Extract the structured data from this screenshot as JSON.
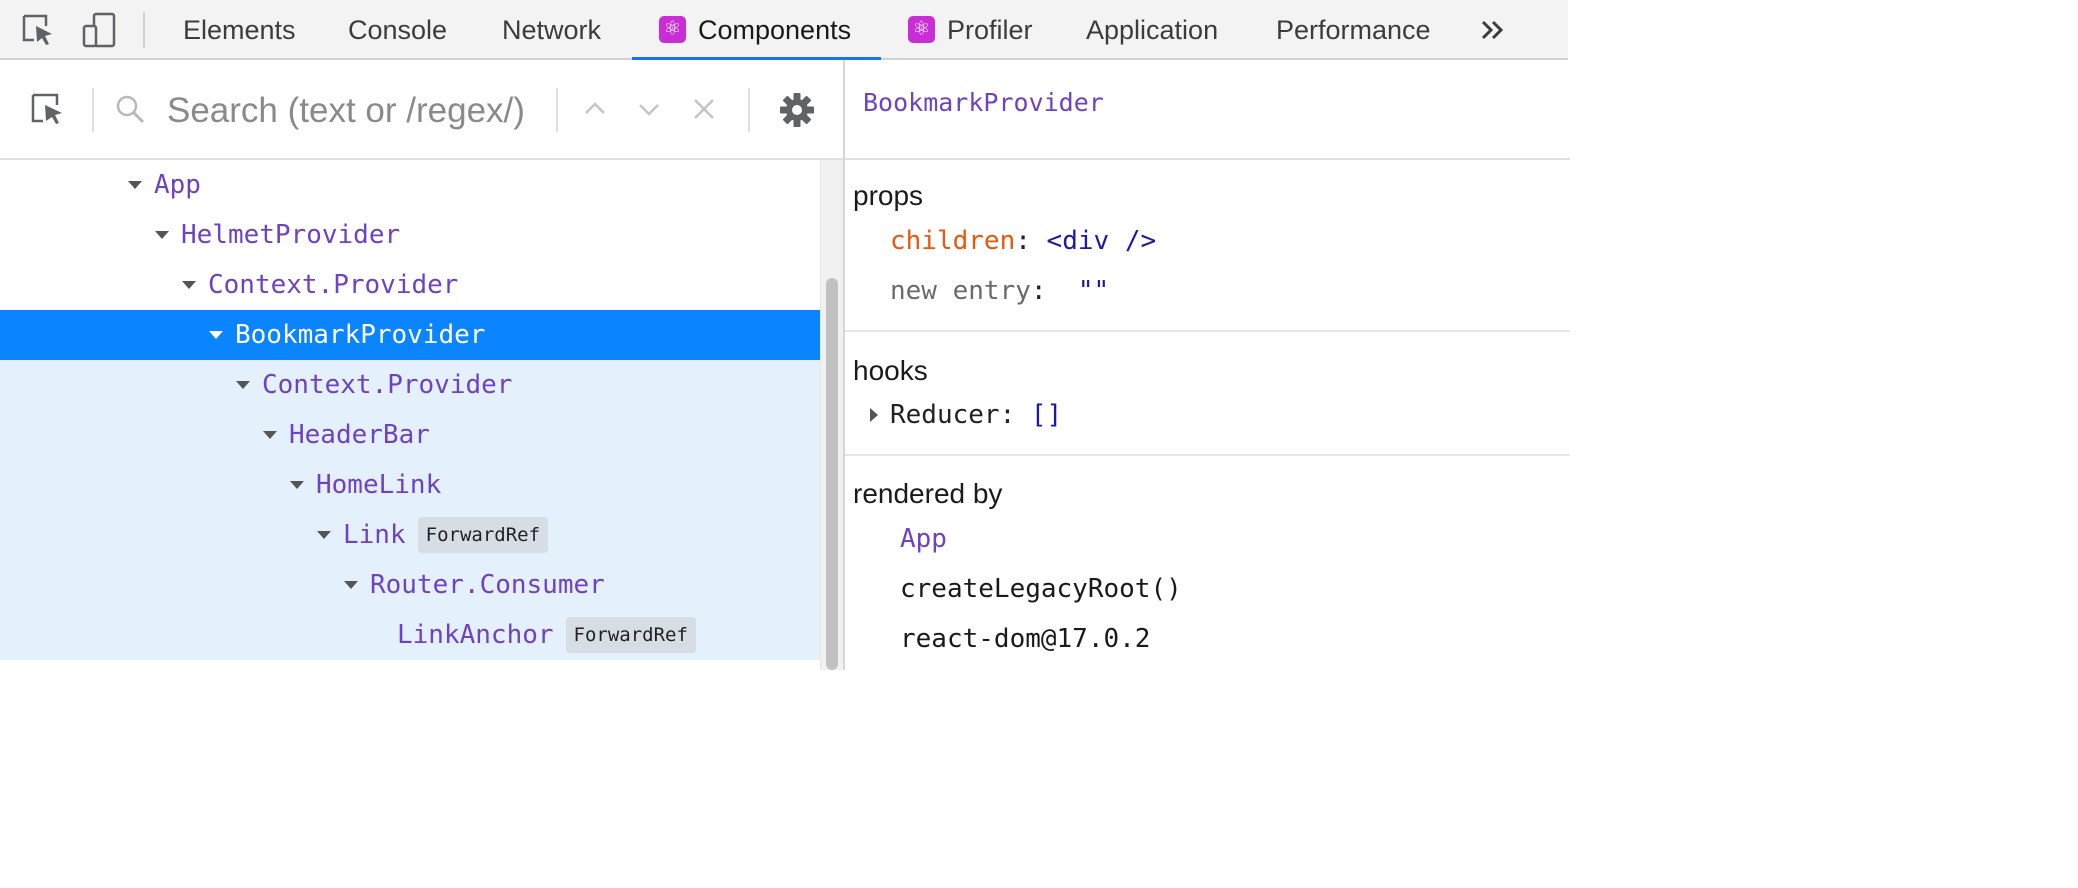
{
  "tabs": {
    "elements": "Elements",
    "console": "Console",
    "network": "Network",
    "components": "Components",
    "profiler": "Profiler",
    "application": "Application",
    "performance": "Performance",
    "react_badge_glyph": "⚛"
  },
  "search": {
    "placeholder": "Search (text or /regex/)",
    "value": ""
  },
  "tree": [
    {
      "name": "App",
      "depth": 0,
      "badge": "",
      "state": "normal",
      "expanded": true
    },
    {
      "name": "HelmetProvider",
      "depth": 1,
      "badge": "",
      "state": "normal",
      "expanded": true
    },
    {
      "name": "Context.Provider",
      "depth": 2,
      "badge": "",
      "state": "normal",
      "expanded": true
    },
    {
      "name": "BookmarkProvider",
      "depth": 3,
      "badge": "",
      "state": "selected",
      "expanded": true
    },
    {
      "name": "Context.Provider",
      "depth": 4,
      "badge": "",
      "state": "sub",
      "expanded": true
    },
    {
      "name": "HeaderBar",
      "depth": 5,
      "badge": "",
      "state": "sub",
      "expanded": true
    },
    {
      "name": "HomeLink",
      "depth": 6,
      "badge": "",
      "state": "sub",
      "expanded": true
    },
    {
      "name": "Link",
      "depth": 7,
      "badge": "ForwardRef",
      "state": "sub",
      "expanded": true
    },
    {
      "name": "Router.Consumer",
      "depth": 8,
      "badge": "",
      "state": "sub",
      "expanded": true
    },
    {
      "name": "LinkAnchor",
      "depth": 9,
      "badge": "ForwardRef",
      "state": "sub",
      "expanded": false
    }
  ],
  "inspector": {
    "title": "BookmarkProvider",
    "props_title": "props",
    "props": [
      {
        "key": "children",
        "sep": ": ",
        "value": "<div />",
        "muted": false
      },
      {
        "key": "new entry",
        "sep": ":  ",
        "value": "\"\"",
        "muted": true
      }
    ],
    "hooks_title": "hooks",
    "hooks": [
      {
        "name": "Reducer",
        "sep": ": ",
        "value": "[]"
      }
    ],
    "rendered_by_title": "rendered by",
    "rendered_by": [
      {
        "label": "App",
        "kind": "component"
      },
      {
        "label": "createLegacyRoot()",
        "kind": "plain"
      },
      {
        "label": "react-dom@17.0.2",
        "kind": "plain"
      }
    ]
  },
  "colors": {
    "accent": "#1a73e8",
    "selected_row": "#0a84ff",
    "subtree_bg": "#e4f1fd",
    "component_name": "#6f42c1",
    "prop_key": "#e8590c",
    "react_badge": "#c92dd6"
  }
}
